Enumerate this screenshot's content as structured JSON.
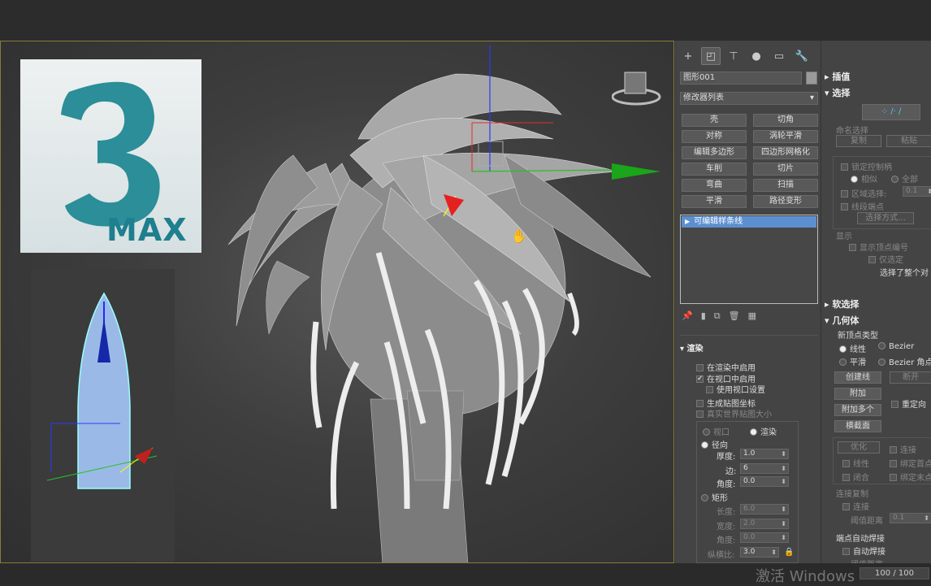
{
  "viewport": {
    "logo_text": "MAX"
  },
  "watermark": "激活 Windows",
  "frame_counter": "100 / 100",
  "command_panel": {
    "tabs": [
      "create",
      "modify",
      "hierarchy",
      "motion",
      "display",
      "utilities"
    ],
    "object_name": "图形001",
    "modifier_list": "修改器列表",
    "modifier_buttons": [
      "壳",
      "切角",
      "对称",
      "涡轮平滑",
      "编辑多边形",
      "四边形网格化",
      "车削",
      "切片",
      "弯曲",
      "扫描",
      "平滑",
      "路径变形"
    ],
    "stack_item": "可编辑样条线",
    "render_rollout": {
      "title": "渲染",
      "enable_in_renderer": "在渲染中启用",
      "enable_in_viewport": "在视口中启用",
      "use_viewport_settings": "使用视口设置",
      "generate_mapping": "生成贴图坐标",
      "real_world_map_size": "真实世界贴图大小",
      "viewport": "视口",
      "renderer": "渲染",
      "radial": "径向",
      "thickness_label": "厚度:",
      "thickness": "1.0",
      "sides_label": "边:",
      "sides": "6",
      "angle_label": "角度:",
      "angle": "0.0",
      "rectangular": "矩形",
      "length_label": "长度:",
      "length": "6.0",
      "width_label": "宽度:",
      "width": "2.0",
      "angle2_label": "角度:",
      "angle2": "0.0",
      "aspect_label": "纵横比:",
      "aspect": "3.0"
    }
  },
  "right_panel": {
    "interpolation": "插值",
    "selection": "选择",
    "named_selections": "命名选择",
    "copy": "复制",
    "paste": "粘贴",
    "lock_handles": "锁定控制柄",
    "alike": "相似",
    "all": "全部",
    "area_selection": "区域选择:",
    "area_value": "0.1",
    "segment_end": "线段端点",
    "select_by": "选择方式...",
    "display": "显示",
    "show_vertex_numbers": "显示顶点编号",
    "selected_only": "仅选定",
    "selected_info": "选择了整个对",
    "soft_selection": "软选择",
    "geometry": "几何体",
    "new_vertex_type": "新顶点类型",
    "linear": "线性",
    "bezier": "Bezier",
    "smooth": "平滑",
    "bezier_corner": "Bezier 角点",
    "create_line": "创建线",
    "break": "断开",
    "attach": "附加",
    "attach_mult": "附加多个",
    "reorient": "重定向",
    "cross_section": "横截面",
    "refine": "优化",
    "connect": "连接",
    "linear2": "线性",
    "bind_first": "绑定首点",
    "closed": "闭合",
    "bind_last": "绑定末点",
    "connect_copy": "连接复制",
    "connect2": "连接",
    "threshold": "阈值距离",
    "threshold_value": "0.1",
    "end_auto_weld": "端点自动焊接",
    "auto_weld": "自动焊接",
    "weld_threshold": "阈值距离"
  }
}
